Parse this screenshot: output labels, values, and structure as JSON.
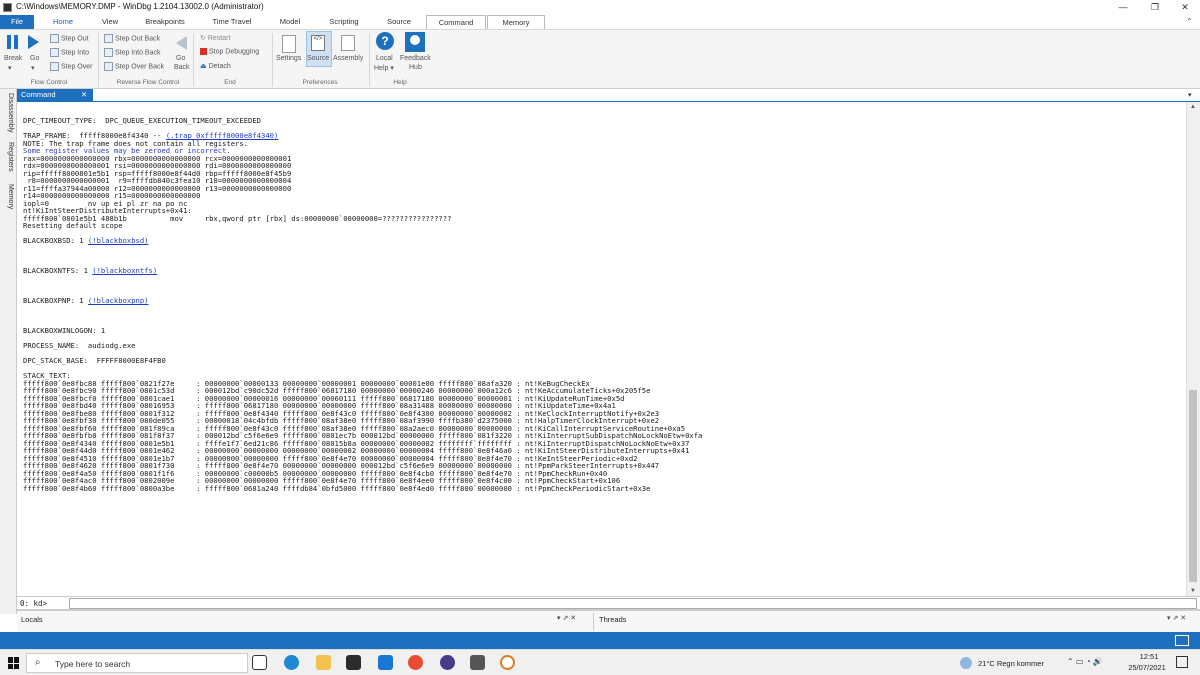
{
  "window": {
    "title": "C:\\Windows\\MEMORY.DMP - WinDbg 1.2104.13002.0 (Administrator)",
    "controls": {
      "minimize": "—",
      "maximize": "❐",
      "close": "✕"
    }
  },
  "ribbon": {
    "tabs": [
      "File",
      "Home",
      "View",
      "Breakpoints",
      "Time Travel",
      "Model",
      "Scripting",
      "Source",
      "Command",
      "Memory"
    ],
    "flow_control": {
      "break": "Break",
      "go": "Go",
      "step_out": "Step Out",
      "step_into": "Step Into",
      "step_over": "Step Over",
      "group": "Flow Control"
    },
    "reverse_flow": {
      "step_out_back": "Step Out Back",
      "step_into_back": "Step Into Back",
      "step_over_back": "Step Over Back",
      "go_back": "Go",
      "go_back2": "Back",
      "group": "Reverse Flow Control"
    },
    "end": {
      "restart": "Restart",
      "stop": "Stop Debugging",
      "detach": "Detach",
      "group": "End"
    },
    "preferences": {
      "settings": "Settings",
      "source": "Source",
      "assembly": "Assembly",
      "group": "Preferences"
    },
    "help": {
      "local_help": "Local",
      "local_help2": "Help ▾",
      "feedback": "Feedback",
      "feedback2": "Hub",
      "group": "Help"
    }
  },
  "left_tabs": [
    "Disassembly",
    "Registers",
    "Memory"
  ],
  "command_tab": "Command",
  "output_lines": [
    {
      "t": "DPC_TIMEOUT_TYPE:  DPC_QUEUE_EXECUTION_TIMEOUT_EXCEEDED"
    },
    {
      "t": ""
    },
    {
      "t": "TRAP_FRAME:  fffff8000e8f4340 -- ",
      "link": "(.trap 0xfffff8000e8f4340)"
    },
    {
      "t": "NOTE: The trap frame does not contain all registers."
    },
    {
      "t": "Some register values may be zeroed or incorrect.",
      "cls": "blue"
    },
    {
      "t": "rax=0000000000000000 rbx=0000000000000000 rcx=0000000000000001"
    },
    {
      "t": "rdx=0000000000000001 rsi=0000000000000000 rdi=0000000000000000"
    },
    {
      "t": "rip=fffff8000801e5b1 rsp=fffff8000e8f44d0 rbp=fffff8000e8f45b9"
    },
    {
      "t": " r8=0000000000000001  r9=ffffdb840c3fea10 r10=0000000000000004"
    },
    {
      "t": "r11=ffffa37944a00000 r12=0000000000000000 r13=0000000000000000"
    },
    {
      "t": "r14=0000000000000000 r15=0000000000000000"
    },
    {
      "t": "iopl=0         nv up ei pl zr na po nc"
    },
    {
      "t": "nt!KiIntSteerDistributeInterrupts+0x41:"
    },
    {
      "t": "fffff800`0801e5b1 488b1b          mov     rbx,qword ptr [rbx] ds:00000000`00000000=????????????????"
    },
    {
      "t": "Resetting default scope"
    },
    {
      "t": ""
    },
    {
      "t": "BLACKBOXBSD: 1 ",
      "link": "(!blackboxbsd)"
    },
    {
      "t": ""
    },
    {
      "t": ""
    },
    {
      "t": ""
    },
    {
      "t": "BLACKBOXNTFS: 1 ",
      "link": "(!blackboxntfs)"
    },
    {
      "t": ""
    },
    {
      "t": ""
    },
    {
      "t": ""
    },
    {
      "t": "BLACKBOXPNP: 1 ",
      "link": "(!blackboxpnp)"
    },
    {
      "t": ""
    },
    {
      "t": ""
    },
    {
      "t": ""
    },
    {
      "t": "BLACKBOXWINLOGON: 1"
    },
    {
      "t": ""
    },
    {
      "t": "PROCESS_NAME:  audiodg.exe"
    },
    {
      "t": ""
    },
    {
      "t": "DPC_STACK_BASE:  FFFFF8000E8F4FB0"
    },
    {
      "t": ""
    },
    {
      "t": "STACK_TEXT:"
    },
    {
      "t": "fffff800`0e8fbc88 fffff800`0821f27e     : 00000000`00000133 00000000`00000001 00000000`00001e00 fffff800`08afa320 : nt!KeBugCheckEx"
    },
    {
      "t": "fffff800`0e8fbc90 fffff800`0801c53d     : 000012bd`c90dc52d fffff800`06817180 00000000`00000246 00000000`000a12c6 : nt!KeAccumulateTicks+0x205f5e"
    },
    {
      "t": "fffff800`0e8fbcf0 fffff800`0801cae1     : 00000000`00000016 00000000`00060111 fffff800`06817180 00000000`00000001 : nt!KiUpdateRunTime+0x5d"
    },
    {
      "t": "fffff800`0e8fbd40 fffff800`08016953     : fffff800`06817180 00000000`00000000 fffff800`08a31488 00000000`00000000 : nt!KiUpdateTime+0x4a1"
    },
    {
      "t": "fffff800`0e8fbe80 fffff800`0801f312     : fffff800`0e8f4340 fffff800`0e8f43c0 fffff800`0e8f4300 00000000`00000002 : nt!KeClockInterruptNotify+0x2e3"
    },
    {
      "t": "fffff800`0e8fbf30 fffff800`080de055     : 00000018`04c4bfdb fffff800`08af38e0 fffff800`08af3990 ffffb380`d2375000 : nt!HalpTimerClockInterrupt+0xe2"
    },
    {
      "t": "fffff800`0e8fbf60 fffff800`081f89ca     : fffff800`0e8f43c0 fffff800`08af38e0 fffff800`08a2aec0 00000000`00000000 : nt!KiCallInterruptServiceRoutine+0xa5"
    },
    {
      "t": "fffff800`0e8fbfb0 fffff800`081f8f37     : 000012bd`c5f6e6e9 fffff800`0801ec7b 000012bd`00000000 fffff800`081f3220 : nt!KiInterruptSubDispatchNoLockNoEtw+0xfa"
    },
    {
      "t": "fffff800`0e8f4340 fffff800`0801e5b1     : ffffe1f7`6ed21c86 fffff800`08015b8a 00000000`00000002 ffffffff`ffffffff : nt!KiInterruptDispatchNoLockNoEtw+0x37"
    },
    {
      "t": "fffff800`0e8f44d0 fffff800`0801e462     : 00000000`00000000 00000000`00000002 00000000`00000004 fffff800`0e8f46a0 : nt!KiIntSteerDistributeInterrupts+0x41"
    },
    {
      "t": "fffff800`0e8f4510 fffff800`0801e1b7     : 00000000`00000000 fffff800`0e8f4e70 00000000`00000004 fffff800`0e8f4e70 : nt!KeIntSteerPeriodic+0xd2"
    },
    {
      "t": "fffff800`0e8f4620 fffff800`0801f730     : fffff800`0e8f4e70 00000000`00000000 000012bd`c5f6e6e9 00000000`00000000 : nt!PpmParkSteerInterrupts+0x447"
    },
    {
      "t": "fffff800`0e8f4a50 fffff800`0801f1f6     : 00000000`c00000b5 00000000`00000000 fffff800`0e8f4cb0 fffff800`0e8f4e70 : nt!PpmCheckRun+0x40"
    },
    {
      "t": "fffff800`0e8f4ac0 fffff800`0802009e     : 00000000`00000000 fffff800`0e8f4e70 fffff800`0e8f4ee0 fffff800`0e8f4c00 : nt!PpmCheckStart+0x106"
    },
    {
      "t": "fffff800`0e8f4b60 fffff800`0800a3be     : fffff800`0681a240 ffffdb84`0bfd5000 fffff800`0e8f4ed0 fffff800`00000000 : nt!PpmCheckPeriodicStart+0x3e"
    }
  ],
  "prompt": {
    "text": "0: kd>"
  },
  "bottom_panes": {
    "locals": "Locals",
    "threads": "Threads"
  },
  "taskbar": {
    "search_placeholder": "Type here to search",
    "weather": "21°C  Regn kommer",
    "time": "12:51",
    "date": "25/07/2021"
  },
  "colors": {
    "accent": "#1f6fbf",
    "link": "#1a3ec8"
  }
}
